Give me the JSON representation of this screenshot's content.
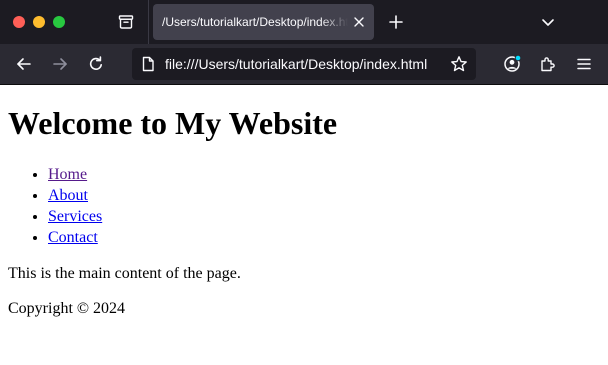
{
  "tab": {
    "title": "/Users/tutorialkart/Desktop/index.html"
  },
  "toolbar": {
    "url": "file:///Users/tutorialkart/Desktop/index.html",
    "icons": [
      "back-icon",
      "forward-icon",
      "reload-icon",
      "page-icon",
      "bookmark-star-icon",
      "account-icon",
      "extensions-icon",
      "menu-icon"
    ],
    "account_badge_color": "#00ddff"
  },
  "page": {
    "heading": "Welcome to My Website",
    "nav_links": [
      {
        "label": "Home",
        "visited": true
      },
      {
        "label": "About",
        "visited": false
      },
      {
        "label": "Services",
        "visited": false
      },
      {
        "label": "Contact",
        "visited": false
      }
    ],
    "main_text": "This is the main content of the page.",
    "footer_text": "Copyright © 2024"
  },
  "colors": {
    "tabstrip_bg": "#1c1b22",
    "navbar_bg": "#2b2a33",
    "active_tab_bg": "#42414d",
    "link": "#0000ee",
    "visited_link": "#551a8b"
  }
}
